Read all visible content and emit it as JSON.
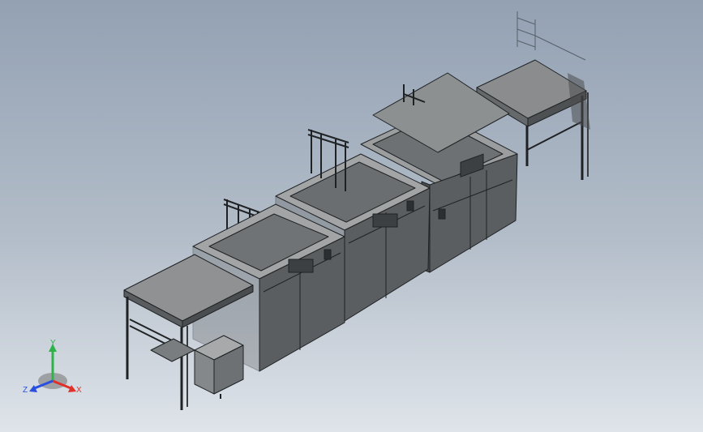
{
  "viewport": {
    "background_top": "#93a1b3",
    "background_bottom": "#dfe4ea",
    "model_fill_dark": "#5b5e60",
    "model_fill_mid": "#7a7d7f",
    "model_fill_light": "#9b9d9e",
    "edge_color": "#1f2224"
  },
  "triad": {
    "x_label": "X",
    "y_label": "Y",
    "z_label": "Z",
    "x_color": "#e0302a",
    "y_color": "#2fb24a",
    "z_color": "#2a4fe0"
  }
}
